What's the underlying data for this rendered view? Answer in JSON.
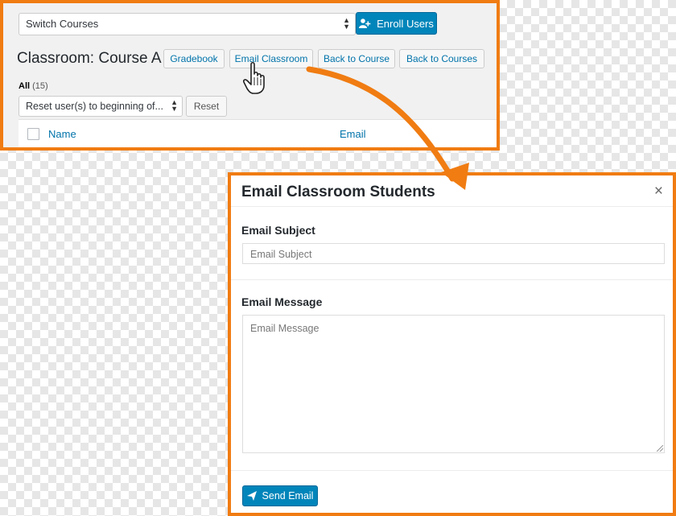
{
  "top_panel": {
    "switch_courses": "Switch Courses",
    "enroll_users": "Enroll Users",
    "title": "Classroom: Course A",
    "buttons": {
      "gradebook": "Gradebook",
      "email_classroom": "Email Classroom",
      "back_to_course": "Back to Course",
      "back_to_courses": "Back to Courses"
    },
    "filter": {
      "label": "All",
      "count": "(15)"
    },
    "bulk_action": "Reset user(s) to beginning of...",
    "reset_button": "Reset",
    "table_columns": [
      "Name",
      "Email"
    ]
  },
  "modal": {
    "title": "Email Classroom Students",
    "close": "×",
    "subject_label": "Email Subject",
    "subject_placeholder": "Email Subject",
    "message_label": "Email Message",
    "message_placeholder": "Email Message",
    "send_button": "Send Email"
  },
  "colors": {
    "accent_orange": "#f07c12",
    "primary_blue": "#0085ba",
    "link_blue": "#0073aa"
  },
  "icons": [
    "add-user-icon",
    "select-arrows-icon",
    "close-icon",
    "send-icon",
    "hand-pointer-icon",
    "annotation-arrow-icon"
  ]
}
